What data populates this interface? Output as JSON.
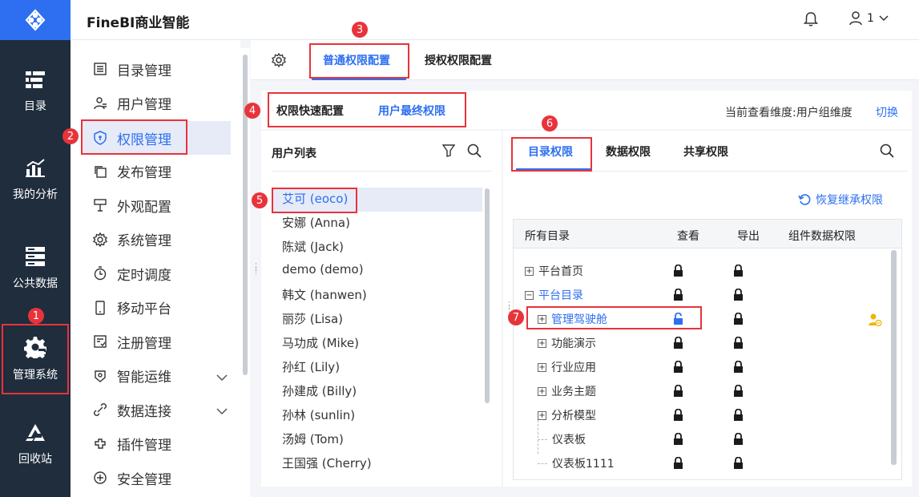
{
  "header": {
    "app_title": "FineBI商业智能",
    "user_label": "1"
  },
  "rail": [
    {
      "label": "目录",
      "icon": "catalog-icon"
    },
    {
      "label": "我的分析",
      "icon": "analysis-icon"
    },
    {
      "label": "公共数据",
      "icon": "database-icon"
    },
    {
      "label": "管理系统",
      "icon": "gear-admin-icon"
    },
    {
      "label": "回收站",
      "icon": "recycle-icon"
    }
  ],
  "menu": [
    {
      "label": "目录管理",
      "icon": "list-icon"
    },
    {
      "label": "用户管理",
      "icon": "user-icon"
    },
    {
      "label": "权限管理",
      "icon": "shield-icon"
    },
    {
      "label": "发布管理",
      "icon": "copy-icon"
    },
    {
      "label": "外观配置",
      "icon": "brush-icon"
    },
    {
      "label": "系统管理",
      "icon": "gear-icon"
    },
    {
      "label": "定时调度",
      "icon": "timer-icon"
    },
    {
      "label": "移动平台",
      "icon": "mobile-icon"
    },
    {
      "label": "注册管理",
      "icon": "register-icon"
    },
    {
      "label": "智能运维",
      "icon": "ops-icon"
    },
    {
      "label": "数据连接",
      "icon": "link-icon"
    },
    {
      "label": "插件管理",
      "icon": "plugin-icon"
    },
    {
      "label": "安全管理",
      "icon": "safety-icon"
    }
  ],
  "tabs": {
    "normal": "普通权限配置",
    "grant": "授权权限配置"
  },
  "subtabs": {
    "quick": "权限快速配置",
    "final": "用户最终权限"
  },
  "dimension": {
    "text": "当前查看维度:用户组维度",
    "switch": "切换"
  },
  "user_list": {
    "title": "用户列表",
    "users": [
      "艾可 (eoco)",
      "安娜 (Anna)",
      "陈斌 (Jack)",
      "demo (demo)",
      "韩文 (hanwen)",
      "丽莎 (Lisa)",
      "马功成 (Mike)",
      "孙红 (Lily)",
      "孙建成 (Billy)",
      "孙林 (sunlin)",
      "汤姆 (Tom)",
      "王国强 (Cherry)"
    ]
  },
  "perm_tabs": [
    "目录权限",
    "数据权限",
    "共享权限"
  ],
  "restore": "恢复继承权限",
  "table": {
    "headers": [
      "所有目录",
      "查看",
      "导出",
      "组件数据权限"
    ],
    "rows": [
      "平台首页",
      "平台目录",
      "管理驾驶舱",
      "功能演示",
      "行业应用",
      "业务主题",
      "分析模型",
      "仪表板",
      "仪表板1111"
    ]
  },
  "badges": [
    "1",
    "2",
    "3",
    "4",
    "5",
    "6",
    "7"
  ],
  "colors": {
    "accent": "#2d6ff0",
    "rail": "#1f2d3d",
    "highlight": "#e8333b"
  }
}
